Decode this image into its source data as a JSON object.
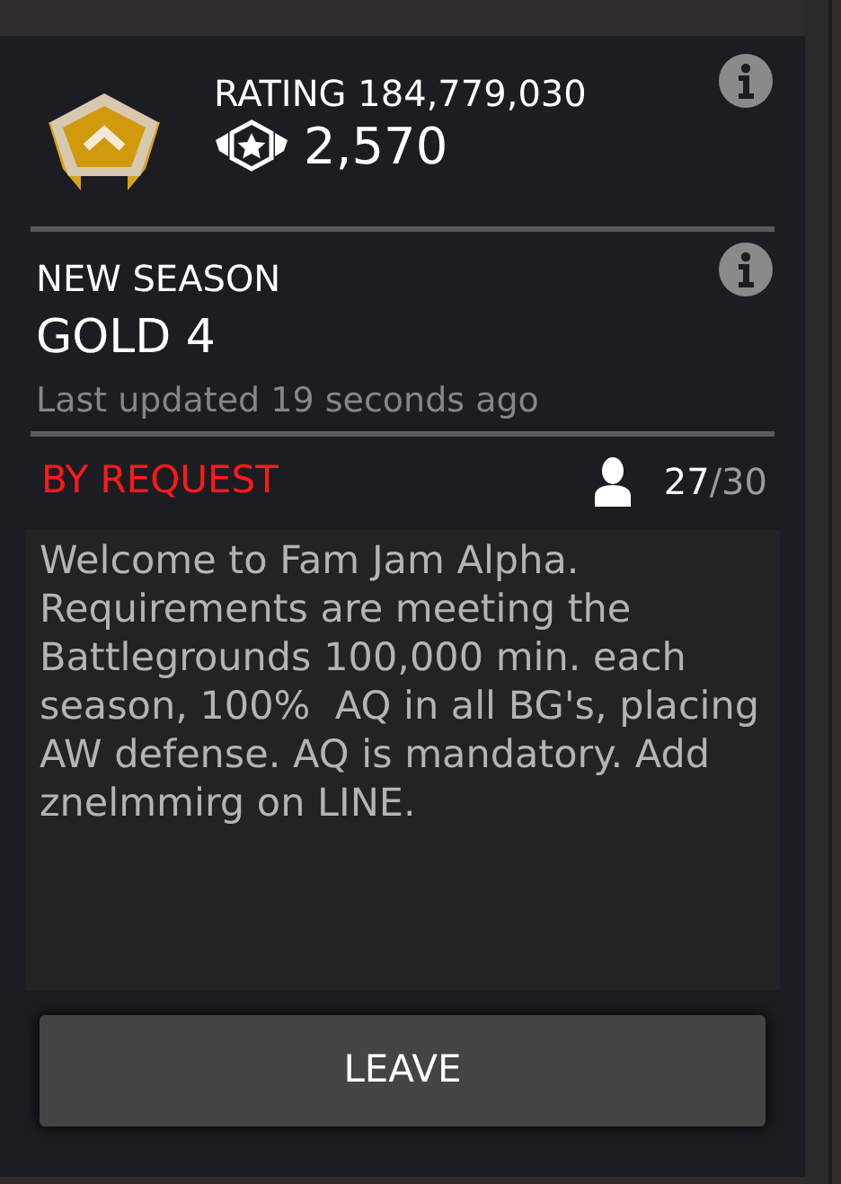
{
  "rating": {
    "label": "RATING 184,779,030",
    "points": "2,570"
  },
  "season": {
    "title": "NEW SEASON",
    "tier": "GOLD 4",
    "updated": "Last updated 19 seconds ago"
  },
  "membership": {
    "policy": "BY REQUEST",
    "count": "27",
    "limit": "/30"
  },
  "description": "Welcome to Fam Jam Alpha. Requirements are meeting the Battlegrounds 100,000 min. each season, 100%  AQ in all BG's, placing AW defense. AQ is mandatory. Add znelmmirg on LINE.",
  "buttons": [
    {
      "label": "LEAVE"
    }
  ]
}
